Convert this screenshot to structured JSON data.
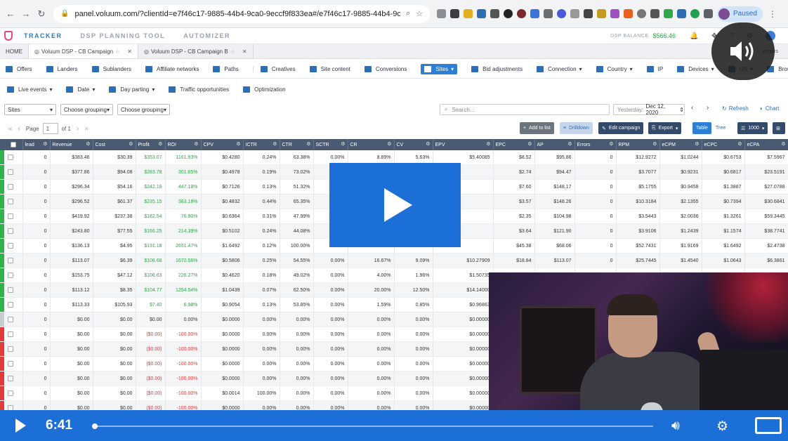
{
  "browser": {
    "url": "panel.voluum.com/?clientId=e7f46c17-9885-44b4-9ca0-9eccf9f833ea#/e7f46c17-9885-44b4-9ca0-9...",
    "profile_status": "Paused"
  },
  "app": {
    "nav": [
      "TRACKER",
      "DSP PLANNING TOOL",
      "AUTOMIZER"
    ],
    "active_nav": "TRACKER",
    "balance_label": "DSP BALANCE",
    "balance_value": "$566.46",
    "brand_color": "#e8467c"
  },
  "tabs": [
    {
      "label": "HOME"
    },
    {
      "label": "Voluum DSP - CB Campaign"
    },
    {
      "label": "Voluum DSP - CB Campaign B"
    }
  ],
  "bookmarks_label": "kmarks",
  "entity_nav": {
    "items": [
      "Offers",
      "Landers",
      "Sublanders",
      "Affiliate networks",
      "Paths",
      "Creatives",
      "Site content",
      "Conversions",
      "Sites",
      "Bid adjustments",
      "Connection",
      "Country",
      "IP",
      "Devices",
      "OS",
      "Brows"
    ],
    "active": "Sites"
  },
  "secondary": {
    "items": [
      "Live events",
      "Date",
      "Day parting",
      "Traffic opportunities",
      "Optimization"
    ]
  },
  "filters": {
    "grouping1": "Sites",
    "grouping2": "Choose grouping",
    "grouping3": "Choose grouping",
    "search_placeholder": "Search...",
    "date_prefix": "Yesterday:",
    "date_value": "Dec 12, 2020",
    "refresh": "Refresh",
    "chart": "Chart"
  },
  "toolbar": {
    "page_label": "Page",
    "page_value": "1",
    "of_label": "of 1",
    "add_to_list": "Add to list",
    "drilldown": "Drilldown",
    "edit_campaign": "Edit campaign",
    "export": "Export",
    "table": "Table",
    "tree": "Tree",
    "rows": "1000"
  },
  "table": {
    "columns": [
      "lead",
      "Revenue",
      "Cost",
      "Profit",
      "ROI",
      "CPV",
      "ICTR",
      "CTR",
      "SCTR",
      "CR",
      "CV",
      "EPV",
      "EPC",
      "AP",
      "Errors",
      "RPM",
      "eCPM",
      "eCPC",
      "eCPA"
    ],
    "rows": [
      {
        "s": "green",
        "c": [
          "0",
          "$383.46",
          "$30.39",
          "$353.07",
          "1161.93%",
          "$0.4280",
          "0.24%",
          "63.38%",
          "0.00%",
          "8.89%",
          "5.63%",
          "$5.40085",
          "$8.52",
          "$95.86",
          "0",
          "$12.9272",
          "$1.0244",
          "$0.6753",
          "$7.5967"
        ]
      },
      {
        "s": "green",
        "c": [
          "0",
          "$377.86",
          "$94.08",
          "$283.78",
          "301.65%",
          "$0.4978",
          "0.19%",
          "73.02%",
          "0.00%",
          "",
          "",
          "",
          "$2.74",
          "$94.47",
          "0",
          "$3.7077",
          "$0.9231",
          "$0.6817",
          "$23.5191"
        ]
      },
      {
        "s": "green",
        "c": [
          "0",
          "$296.34",
          "$54.16",
          "$242.18",
          "447.18%",
          "$0.7126",
          "0.13%",
          "51.32%",
          "0.00%",
          "",
          "",
          "",
          "$7.60",
          "$148.17",
          "0",
          "$5.1755",
          "$0.9458",
          "$1.3887",
          "$27.0788"
        ]
      },
      {
        "s": "green",
        "c": [
          "0",
          "$296.52",
          "$61.37",
          "$235.15",
          "383.18%",
          "$0.4832",
          "0.44%",
          "65.35%",
          "0.00%",
          "",
          "",
          "",
          "$3.57",
          "$148.26",
          "0",
          "$10.3184",
          "$2.1355",
          "$0.7394",
          "$30.6841"
        ]
      },
      {
        "s": "green",
        "c": [
          "0",
          "$419.92",
          "$237.38",
          "$182.54",
          "76.90%",
          "$0.6364",
          "0.31%",
          "47.99%",
          "0.00%",
          "",
          "",
          "",
          "$2.35",
          "$104.98",
          "0",
          "$3.5443",
          "$2.0036",
          "$1.3261",
          "$59.3445"
        ]
      },
      {
        "s": "green",
        "c": [
          "0",
          "$243.80",
          "$77.55",
          "$166.25",
          "214.39%",
          "$0.5102",
          "0.24%",
          "44.08%",
          "0.00%",
          "",
          "",
          "",
          "$3.64",
          "$121.90",
          "0",
          "$3.9106",
          "$1.2439",
          "$1.1574",
          "$38.7741"
        ]
      },
      {
        "s": "green",
        "c": [
          "0",
          "$136.13",
          "$4.95",
          "$131.18",
          "2651.47%",
          "$1.6492",
          "0.12%",
          "100.00%",
          "0.00%",
          "",
          "",
          "",
          "$45.38",
          "$68.06",
          "0",
          "$52.7431",
          "$1.9169",
          "$1.6492",
          "$2.4738"
        ]
      },
      {
        "s": "green",
        "c": [
          "0",
          "$113.07",
          "$6.39",
          "$106.68",
          "1670.56%",
          "$0.5806",
          "0.25%",
          "54.55%",
          "0.00%",
          "16.67%",
          "9.09%",
          "$10.27909",
          "$18.84",
          "$113.07",
          "0",
          "$25.7445",
          "$1.4540",
          "$1.0643",
          "$6.3861"
        ]
      },
      {
        "s": "green",
        "c": [
          "0",
          "$153.75",
          "$47.12",
          "$106.63",
          "226.27%",
          "$0.4620",
          "0.18%",
          "49.02%",
          "0.00%",
          "4.00%",
          "1.96%",
          "$1.50735",
          "",
          "",
          "",
          "",
          "",
          "",
          ""
        ]
      },
      {
        "s": "green",
        "c": [
          "0",
          "$113.12",
          "$8.35",
          "$104.77",
          "1254.54%",
          "$1.0439",
          "0.07%",
          "62.50%",
          "0.00%",
          "20.00%",
          "12.50%",
          "$14.14000",
          "",
          "",
          "",
          "",
          "",
          "",
          ""
        ]
      },
      {
        "s": "green",
        "c": [
          "0",
          "$113.33",
          "$105.93",
          "$7.40",
          "6.98%",
          "$0.9054",
          "0.13%",
          "53.85%",
          "0.00%",
          "1.59%",
          "0.85%",
          "$0.96863",
          "",
          "",
          "",
          "",
          "",
          "",
          ""
        ]
      },
      {
        "s": "grey",
        "c": [
          "0",
          "$0.00",
          "$0.00",
          "$0.00",
          "0.00%",
          "$0.0000",
          "0.00%",
          "0.00%",
          "0.00%",
          "0.00%",
          "0.00%",
          "$0.00000",
          "",
          "",
          "",
          "",
          "",
          "",
          ""
        ]
      },
      {
        "s": "red",
        "c": [
          "0",
          "$0.00",
          "$0.00",
          "($0.00)",
          "-100.00%",
          "$0.0000",
          "0.00%",
          "0.00%",
          "0.00%",
          "0.00%",
          "0.00%",
          "$0.00000",
          "",
          "",
          "",
          "",
          "",
          "",
          ""
        ]
      },
      {
        "s": "red",
        "c": [
          "0",
          "$0.00",
          "$0.00",
          "($0.00)",
          "-100.00%",
          "$0.0000",
          "0.00%",
          "0.00%",
          "0.00%",
          "0.00%",
          "0.00%",
          "$0.00000",
          "",
          "",
          "",
          "",
          "",
          "",
          ""
        ]
      },
      {
        "s": "red",
        "c": [
          "0",
          "$0.00",
          "$0.00",
          "($0.00)",
          "-100.00%",
          "$0.0000",
          "0.00%",
          "0.00%",
          "0.00%",
          "0.00%",
          "0.00%",
          "$0.00000",
          "",
          "",
          "",
          "",
          "",
          "",
          ""
        ]
      },
      {
        "s": "red",
        "c": [
          "0",
          "$0.00",
          "$0.00",
          "($0.00)",
          "-100.00%",
          "$0.0000",
          "0.00%",
          "0.00%",
          "0.00%",
          "0.00%",
          "0.00%",
          "$0.00000",
          "",
          "",
          "",
          "",
          "",
          "",
          ""
        ]
      },
      {
        "s": "red",
        "c": [
          "0",
          "$0.00",
          "$0.00",
          "($0.00)",
          "-100.00%",
          "$0.0014",
          "100.00%",
          "0.00%",
          "0.00%",
          "0.00%",
          "0.00%",
          "$0.00000",
          "",
          "",
          "",
          "",
          "",
          "",
          ""
        ]
      },
      {
        "s": "red",
        "c": [
          "0",
          "$0.00",
          "$0.00",
          "($0.00)",
          "-100.00%",
          "$0.0000",
          "0.00%",
          "0.00%",
          "0.00%",
          "0.00%",
          "0.00%",
          "$0.00000",
          "",
          "",
          "",
          "",
          "",
          "",
          ""
        ]
      }
    ]
  },
  "video": {
    "time": "6:41",
    "progress": 0.002,
    "accent": "#1d6fd8"
  }
}
